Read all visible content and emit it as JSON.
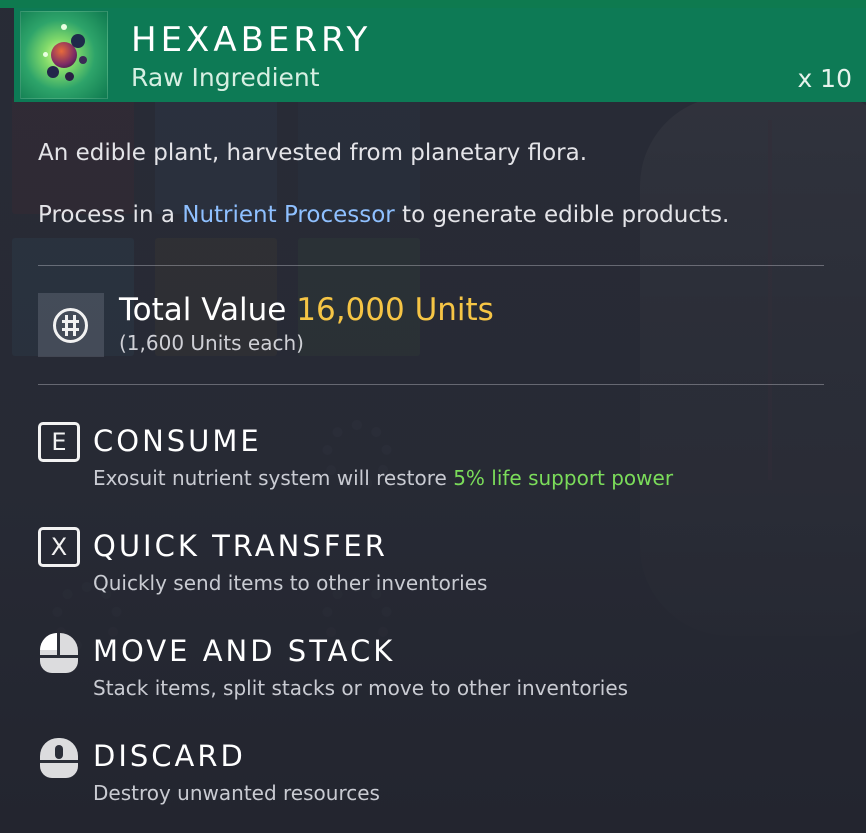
{
  "item": {
    "name": "HEXABERRY",
    "category": "Raw Ingredient",
    "quantity": "x 10",
    "icon": "hexaberry-icon"
  },
  "description": {
    "line1": "An edible plant, harvested from planetary flora.",
    "line2_prefix": "Process in a ",
    "line2_link": "Nutrient Processor",
    "line2_suffix": " to generate edible products."
  },
  "value": {
    "icon": "units-icon",
    "label": "Total Value ",
    "amount": "16,000 Units",
    "each": "(1,600 Units each)"
  },
  "actions": [
    {
      "key": "E",
      "title": "CONSUME",
      "desc_prefix": "Exosuit nutrient system will restore ",
      "desc_highlight": "5% life support power",
      "icon": "key-e-icon"
    },
    {
      "key": "X",
      "title": "QUICK TRANSFER",
      "desc": "Quickly send items to other inventories",
      "icon": "key-x-icon"
    },
    {
      "title": "MOVE AND STACK",
      "desc": "Stack items, split stacks or move to other inventories",
      "icon": "mouse-left-button-icon"
    },
    {
      "title": "DISCARD",
      "desc": "Destroy unwanted resources",
      "icon": "mouse-middle-button-icon"
    }
  ],
  "colors": {
    "header_bg": "#0d7a55",
    "value_amount": "#f6c545",
    "link_blue": "#8fc0ff",
    "positive_green": "#7bdc5a"
  }
}
